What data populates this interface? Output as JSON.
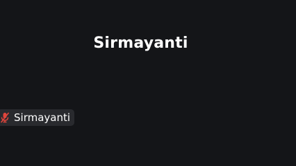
{
  "participant": {
    "display_name": "Sirmayanti",
    "tag_label": "Sirmayanti",
    "mic_status_icon": "mic-muted-icon",
    "mic_icon_color": "#e0453c"
  }
}
